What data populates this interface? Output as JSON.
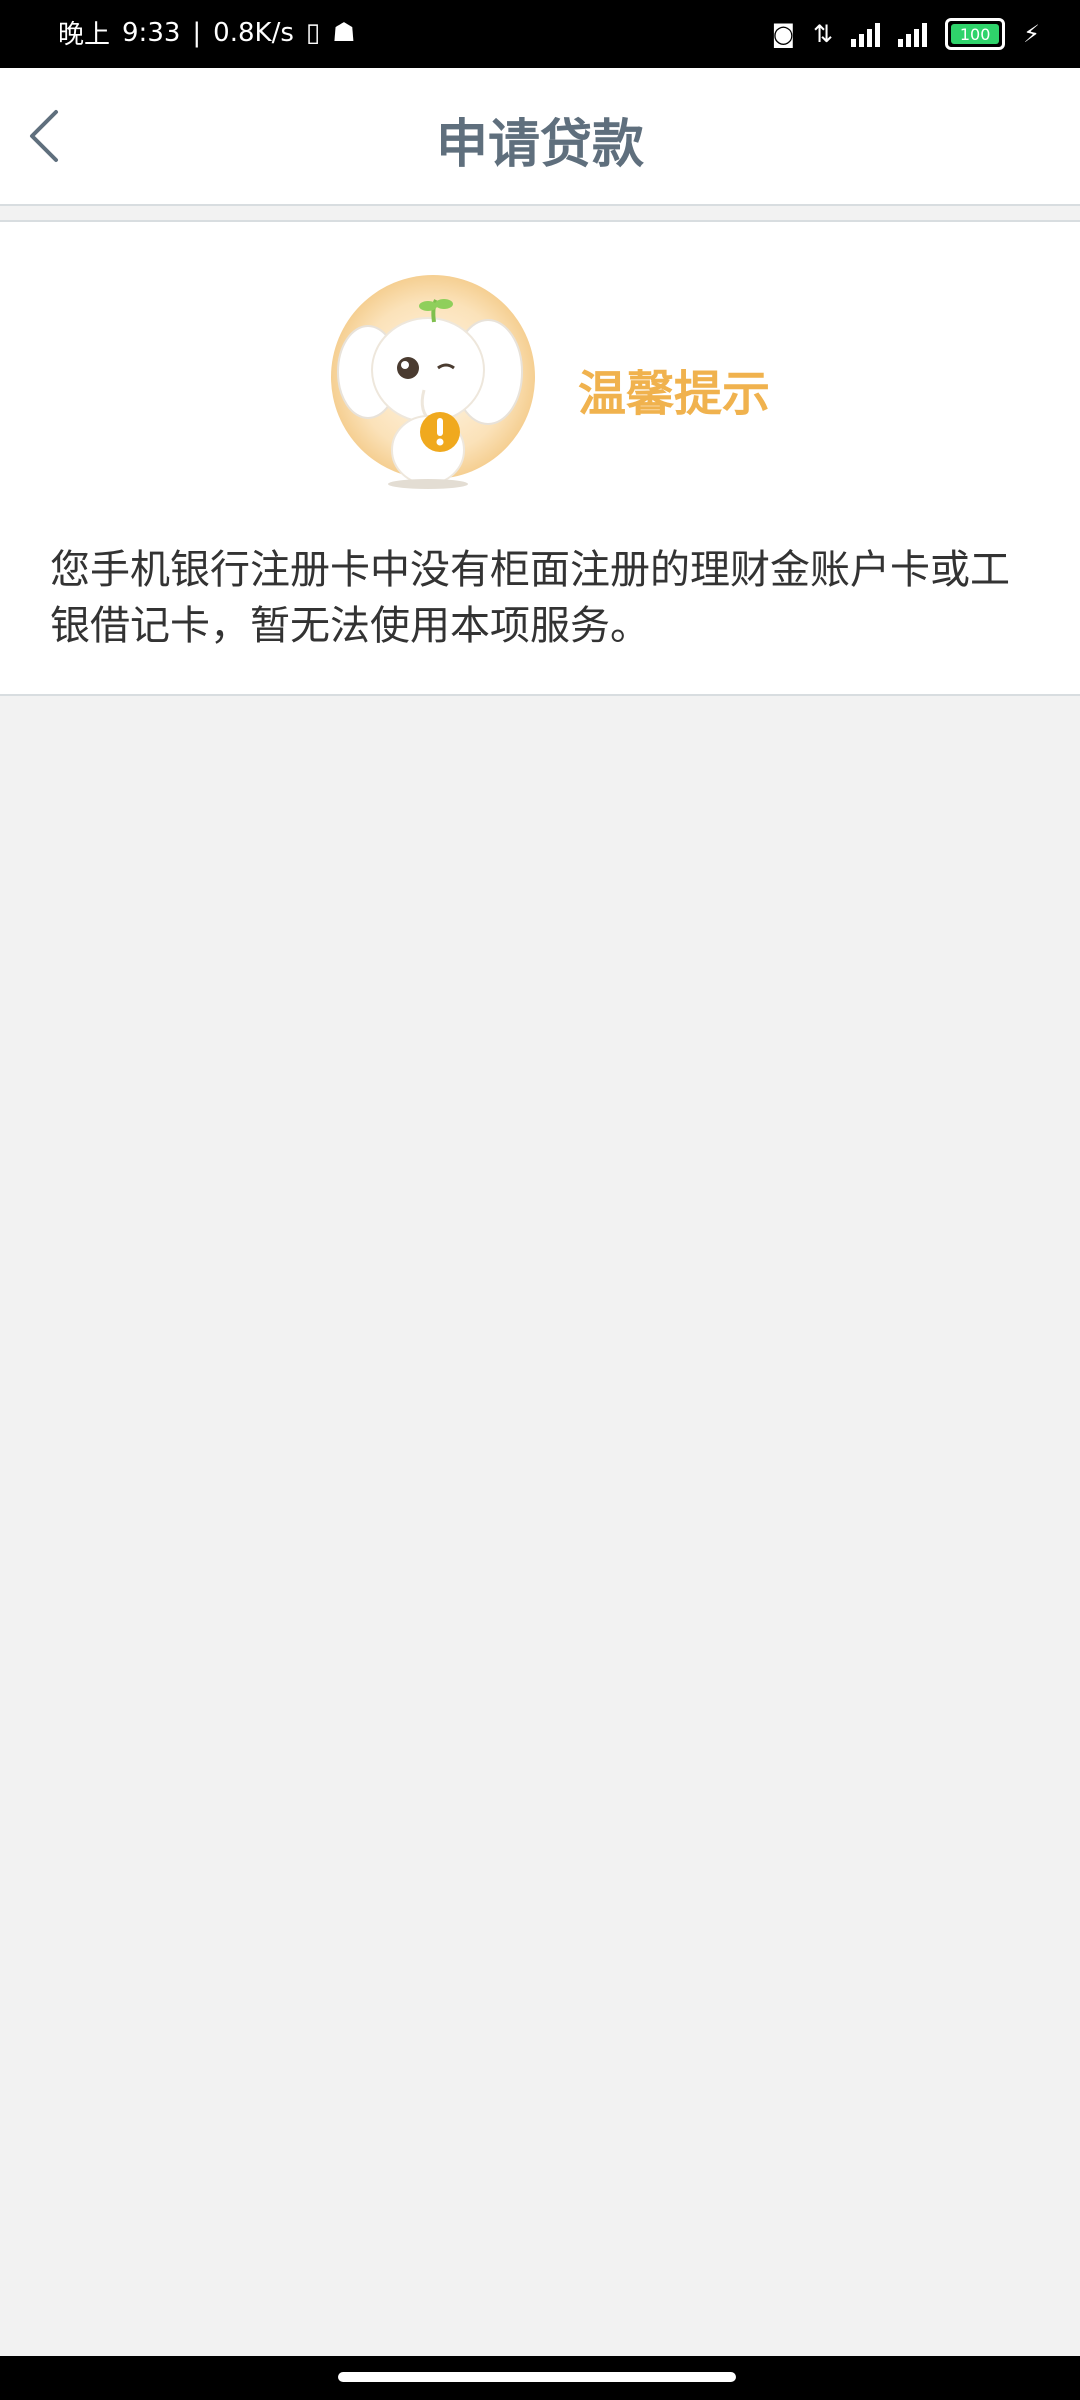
{
  "status_bar": {
    "time_prefix": "晚上",
    "time": "9:33",
    "speed": "0.8K/s",
    "battery": "100"
  },
  "header": {
    "title": "申请贷款"
  },
  "notice": {
    "title": "温馨提示",
    "message": "您手机银行注册卡中没有柜面注册的理财金账户卡或工银借记卡，暂无法使用本项服务。"
  },
  "colors": {
    "title": "#5f6f7d",
    "accent": "#f0b24e"
  }
}
